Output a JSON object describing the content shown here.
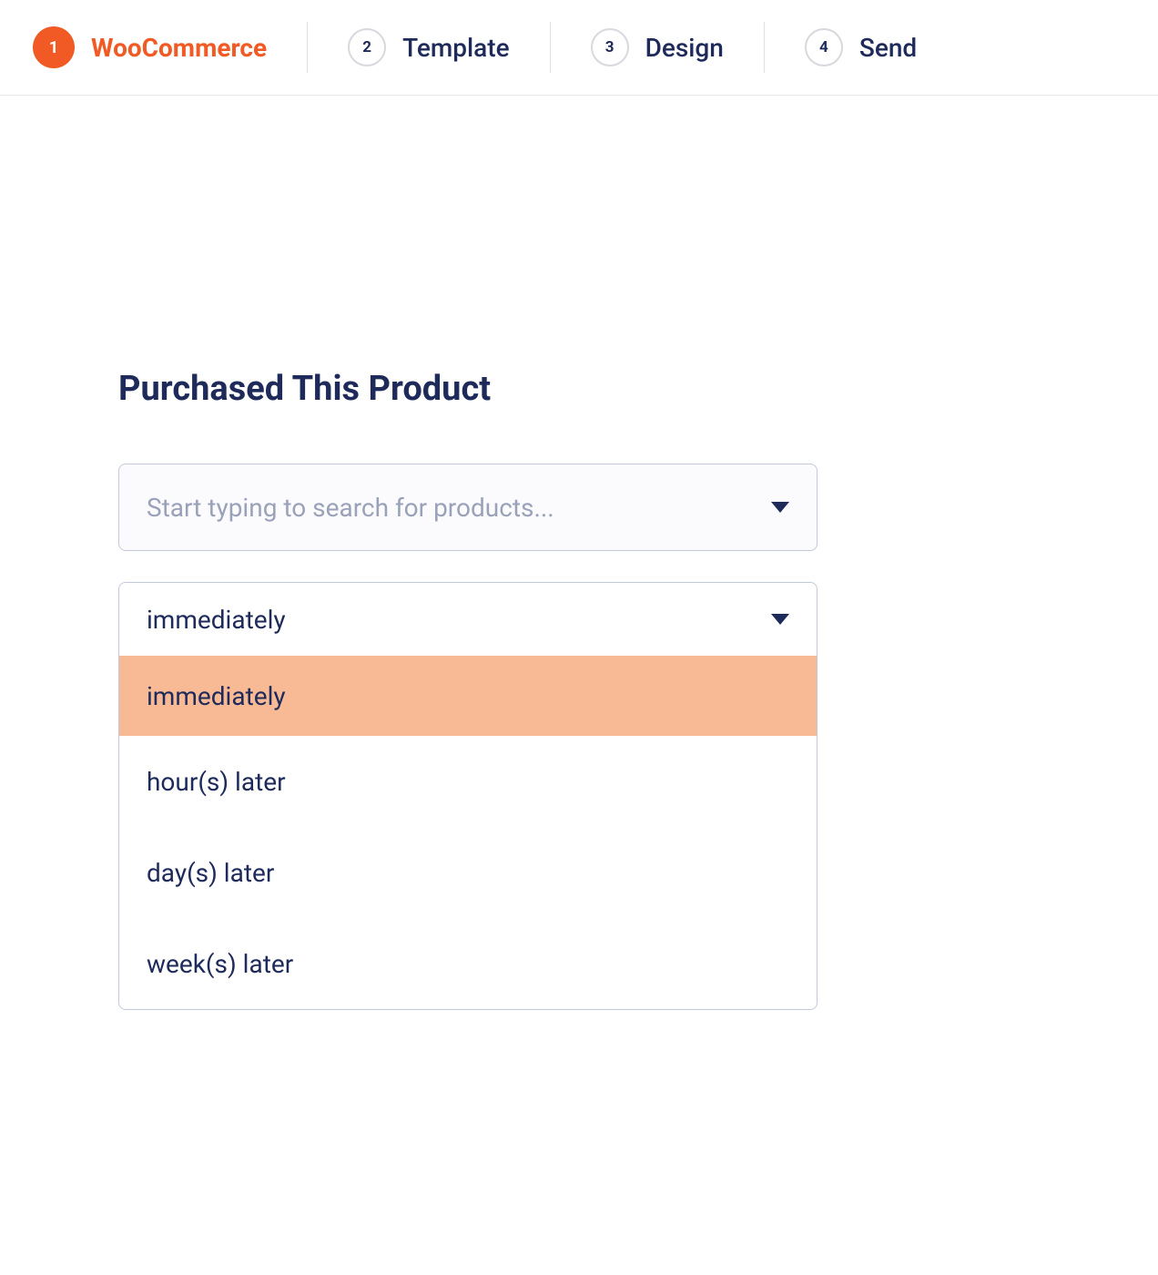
{
  "stepper": {
    "steps": [
      {
        "number": "1",
        "label": "WooCommerce",
        "active": true
      },
      {
        "number": "2",
        "label": "Template",
        "active": false
      },
      {
        "number": "3",
        "label": "Design",
        "active": false
      },
      {
        "number": "4",
        "label": "Send",
        "active": false
      }
    ]
  },
  "section": {
    "title": "Purchased This Product"
  },
  "productSearch": {
    "placeholder": "Start typing to search for products..."
  },
  "timingDropdown": {
    "selected": "immediately",
    "options": [
      {
        "label": "immediately",
        "highlighted": true
      },
      {
        "label": "hour(s) later",
        "highlighted": false
      },
      {
        "label": "day(s) later",
        "highlighted": false
      },
      {
        "label": "week(s) later",
        "highlighted": false
      }
    ]
  }
}
